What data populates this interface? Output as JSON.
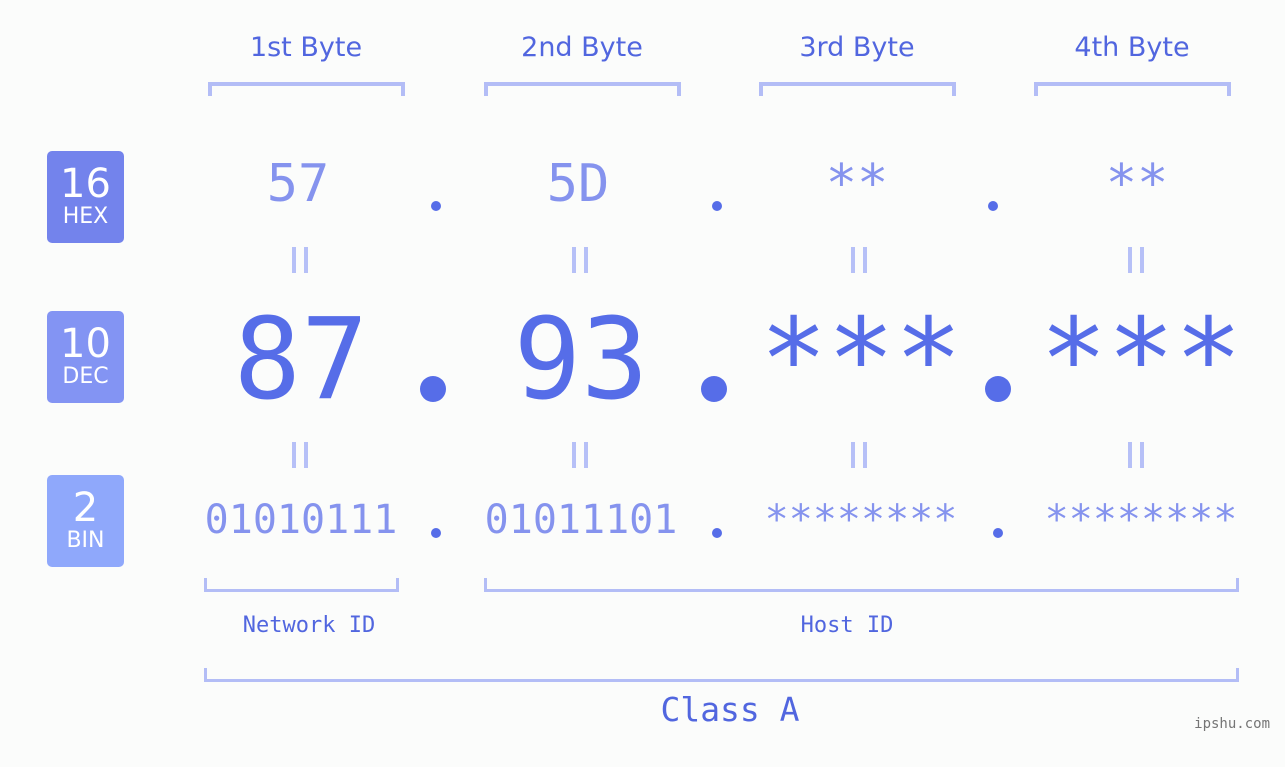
{
  "badges": [
    {
      "number": "16",
      "label": "HEX"
    },
    {
      "number": "10",
      "label": "DEC"
    },
    {
      "number": "2",
      "label": "BIN"
    }
  ],
  "byte_labels": [
    "1st Byte",
    "2nd Byte",
    "3rd Byte",
    "4th Byte"
  ],
  "hex": [
    "57",
    "5D",
    "**",
    "**"
  ],
  "dec": [
    "87",
    "93",
    "***",
    "***"
  ],
  "bin": [
    "01010111",
    "01011101",
    "********",
    "********"
  ],
  "network_id_label": "Network ID",
  "host_id_label": "Host ID",
  "class_label": "Class A",
  "watermark": "ipshu.com",
  "colors": {
    "accent": "#566de8",
    "label_text": "#5166df",
    "light_value": "#8593ee",
    "bracket": "#b3bdf6",
    "hex_badge": "#7383ec",
    "dec_badge": "#8394f3",
    "bin_badge": "#8fa8fb"
  }
}
